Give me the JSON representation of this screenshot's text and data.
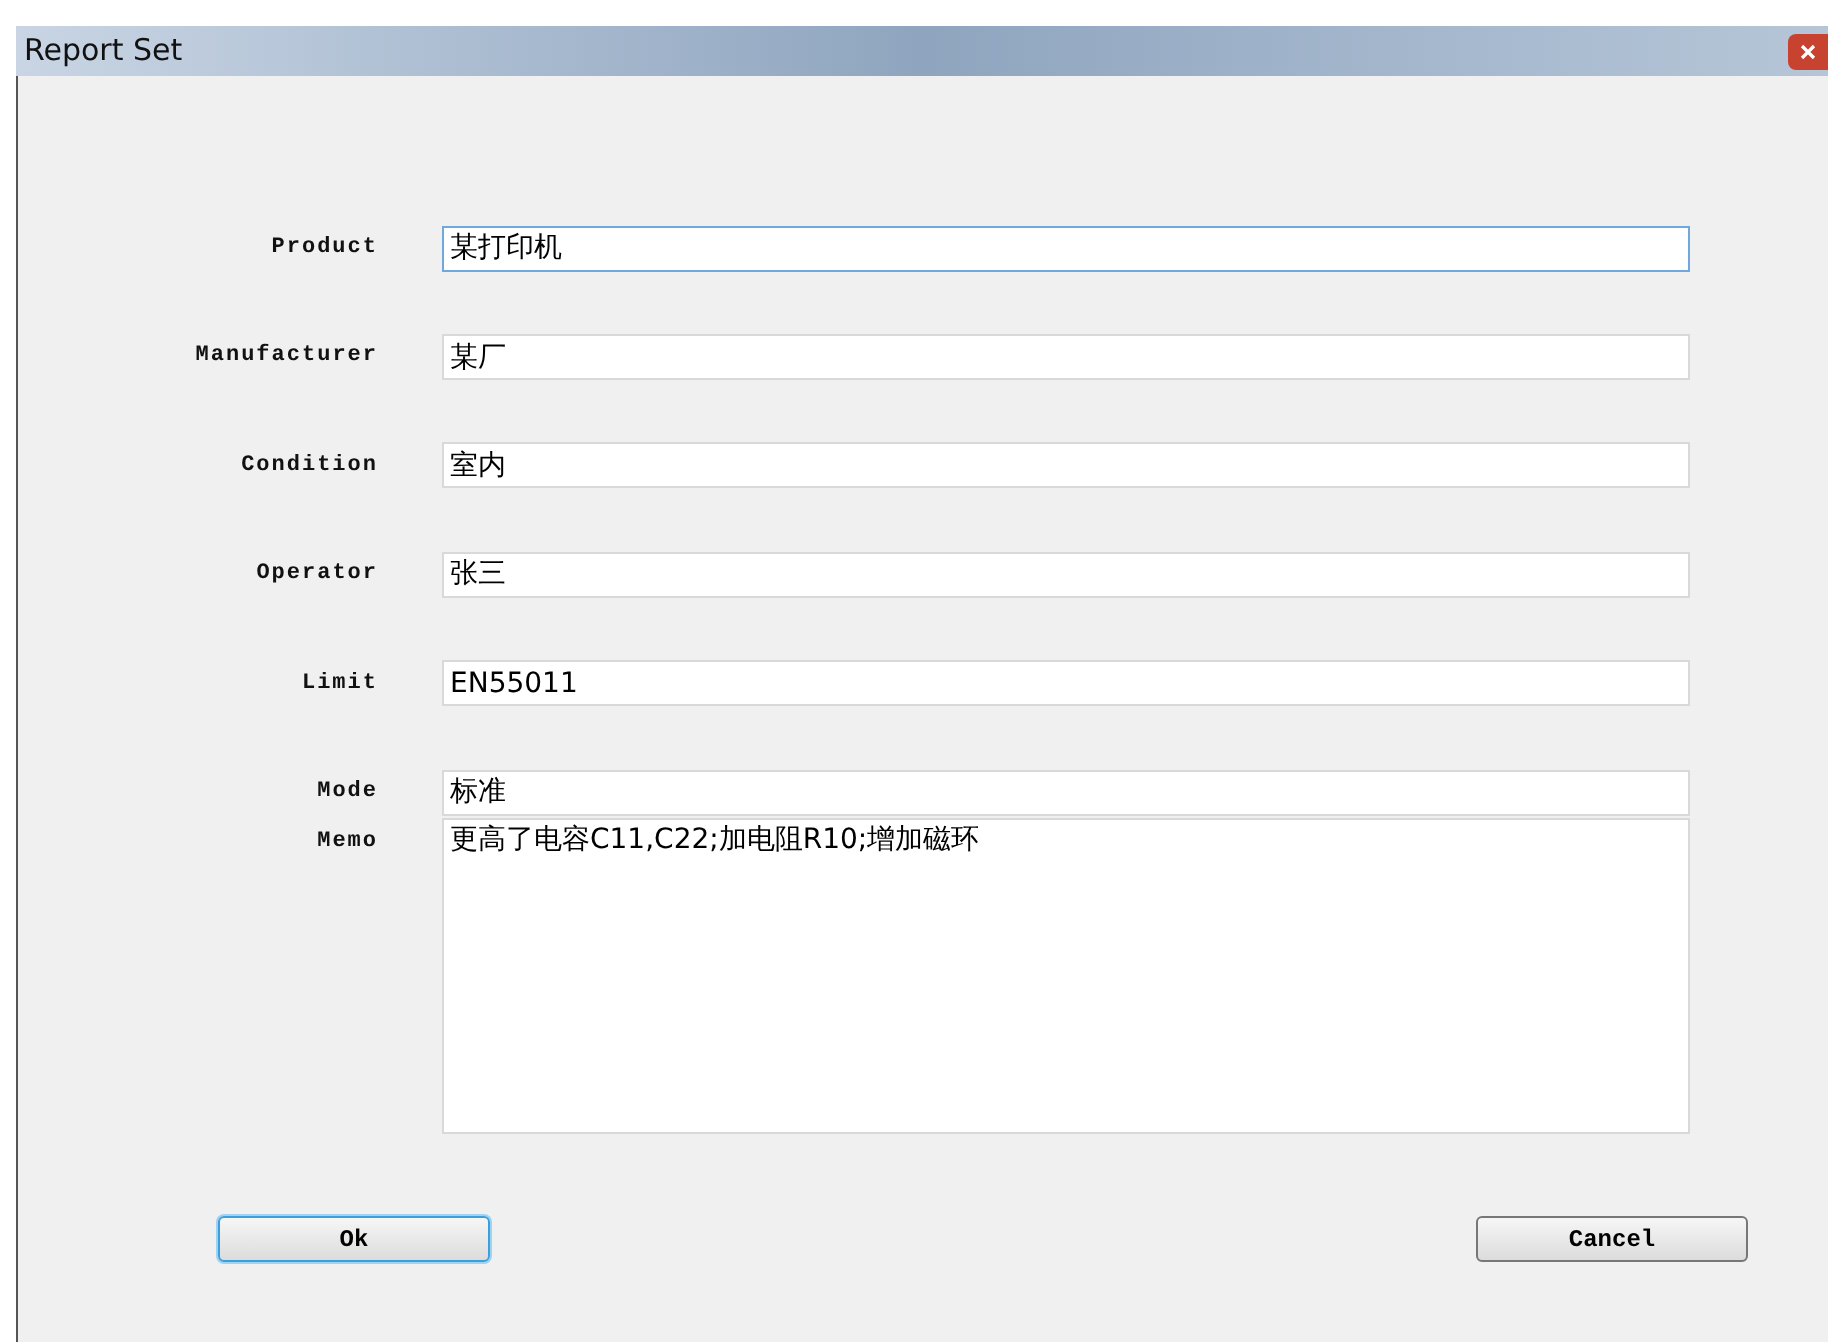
{
  "window": {
    "title": "Report Set"
  },
  "fields": [
    {
      "label": "Product",
      "value": "某打印机",
      "focused": true
    },
    {
      "label": "Manufacturer",
      "value": "某厂",
      "focused": false
    },
    {
      "label": "Condition",
      "value": "室内",
      "focused": false
    },
    {
      "label": "Operator",
      "value": "张三",
      "focused": false
    },
    {
      "label": "Limit",
      "value": "EN55011",
      "focused": false
    },
    {
      "label": "Mode",
      "value": "标准",
      "focused": false
    }
  ],
  "memo": {
    "label": "Memo",
    "value": "更高了电容C11,C22;加电阻R10;增加磁环"
  },
  "buttons": [
    {
      "label": "Ok",
      "default": true
    },
    {
      "label": "Cancel",
      "default": false
    }
  ]
}
